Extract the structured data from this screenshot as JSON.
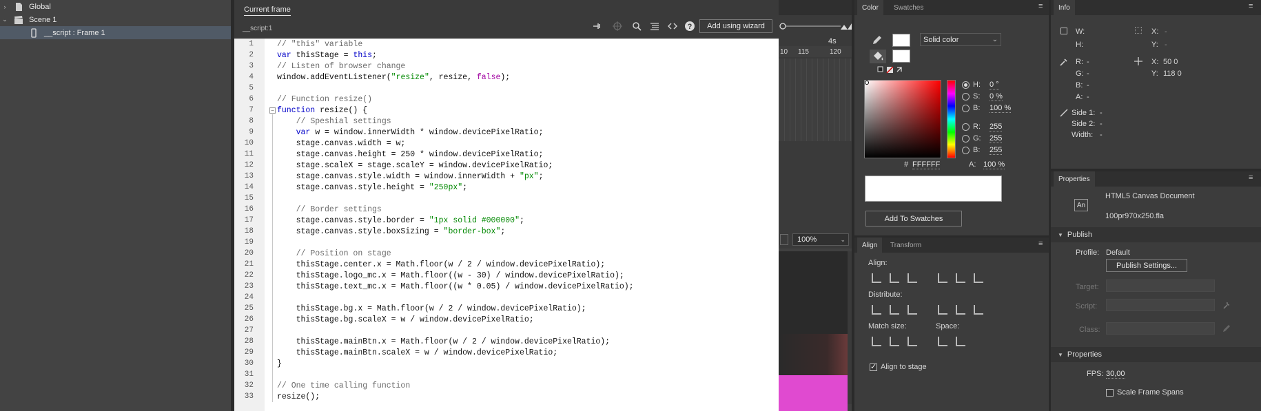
{
  "tree": {
    "items": [
      {
        "label": "Global",
        "arrow": "›",
        "icon": "document-icon"
      },
      {
        "label": "Scene 1",
        "arrow": "⌄",
        "icon": "clapperboard-icon"
      },
      {
        "label": "__script : Frame 1",
        "arrow": "",
        "icon": "phone-frame-icon"
      }
    ]
  },
  "actions": {
    "tab": "Current frame",
    "path": "__script:1",
    "wizard_label": "Add using wizard",
    "help_glyph": "?"
  },
  "code": {
    "line_numbers": [
      "1",
      "2",
      "3",
      "4",
      "5",
      "6",
      "7",
      "8",
      "9",
      "10",
      "11",
      "12",
      "13",
      "14",
      "15",
      "16",
      "17",
      "18",
      "19",
      "20",
      "21",
      "22",
      "23",
      "24",
      "25",
      "26",
      "27",
      "28",
      "29",
      "30",
      "31",
      "32",
      "33"
    ],
    "lines": [
      {
        "segs": [
          {
            "t": "// \"this\" variable",
            "c": "cm"
          }
        ]
      },
      {
        "segs": [
          {
            "t": "var",
            "c": "kw"
          },
          {
            "t": " thisStage = "
          },
          {
            "t": "this",
            "c": "kw"
          },
          {
            "t": ";"
          }
        ]
      },
      {
        "segs": [
          {
            "t": "// Listen of browser change",
            "c": "cm"
          }
        ]
      },
      {
        "segs": [
          {
            "t": "window.addEventListener("
          },
          {
            "t": "\"resize\"",
            "c": "str"
          },
          {
            "t": ", resize, "
          },
          {
            "t": "false",
            "c": "bool"
          },
          {
            "t": ");"
          }
        ]
      },
      {
        "segs": []
      },
      {
        "segs": [
          {
            "t": "// Function resize()",
            "c": "cm"
          }
        ]
      },
      {
        "segs": [
          {
            "t": "function",
            "c": "kw"
          },
          {
            "t": " resize() {"
          }
        ]
      },
      {
        "segs": [
          {
            "t": "    "
          },
          {
            "t": "// Speshial settings",
            "c": "cm"
          }
        ]
      },
      {
        "segs": [
          {
            "t": "    "
          },
          {
            "t": "var",
            "c": "kw"
          },
          {
            "t": " w = window.innerWidth * window.devicePixelRatio;"
          }
        ]
      },
      {
        "segs": [
          {
            "t": "    stage.canvas.width = w;"
          }
        ]
      },
      {
        "segs": [
          {
            "t": "    stage.canvas.height = 250 * window.devicePixelRatio;"
          }
        ]
      },
      {
        "segs": [
          {
            "t": "    stage.scaleX = stage.scaleY = window.devicePixelRatio;"
          }
        ]
      },
      {
        "segs": [
          {
            "t": "    stage.canvas.style.width = window.innerWidth + "
          },
          {
            "t": "\"px\"",
            "c": "str"
          },
          {
            "t": ";"
          }
        ]
      },
      {
        "segs": [
          {
            "t": "    stage.canvas.style.height = "
          },
          {
            "t": "\"250px\"",
            "c": "str"
          },
          {
            "t": ";"
          }
        ]
      },
      {
        "segs": []
      },
      {
        "segs": [
          {
            "t": "    "
          },
          {
            "t": "// Border settings",
            "c": "cm"
          }
        ]
      },
      {
        "segs": [
          {
            "t": "    stage.canvas.style.border = "
          },
          {
            "t": "\"1px solid #000000\"",
            "c": "str"
          },
          {
            "t": ";"
          }
        ]
      },
      {
        "segs": [
          {
            "t": "    stage.canvas.style.boxSizing = "
          },
          {
            "t": "\"border-box\"",
            "c": "str"
          },
          {
            "t": ";"
          }
        ]
      },
      {
        "segs": []
      },
      {
        "segs": [
          {
            "t": "    "
          },
          {
            "t": "// Position on stage",
            "c": "cm"
          }
        ]
      },
      {
        "segs": [
          {
            "t": "    thisStage.center.x = Math.floor(w / 2 / window.devicePixelRatio);"
          }
        ]
      },
      {
        "segs": [
          {
            "t": "    thisStage.logo_mc.x = Math.floor((w - 30) / window.devicePixelRatio);"
          }
        ]
      },
      {
        "segs": [
          {
            "t": "    thisStage.text_mc.x = Math.floor((w * 0.05) / window.devicePixelRatio);"
          }
        ]
      },
      {
        "segs": []
      },
      {
        "segs": [
          {
            "t": "    thisStage.bg.x = Math.floor(w / 2 / window.devicePixelRatio);"
          }
        ]
      },
      {
        "segs": [
          {
            "t": "    thisStage.bg.scaleX = w / window.devicePixelRatio;"
          }
        ]
      },
      {
        "segs": []
      },
      {
        "segs": [
          {
            "t": "    thisStage.mainBtn.x = Math.floor(w / 2 / window.devicePixelRatio);"
          }
        ]
      },
      {
        "segs": [
          {
            "t": "    thisStage.mainBtn.scaleX = w / window.devicePixelRatio;"
          }
        ]
      },
      {
        "segs": [
          {
            "t": "}"
          }
        ]
      },
      {
        "segs": []
      },
      {
        "segs": [
          {
            "t": "// One time calling function",
            "c": "cm"
          }
        ]
      },
      {
        "segs": [
          {
            "t": "resize();"
          }
        ]
      }
    ]
  },
  "timeline": {
    "marker": "4s",
    "frames": [
      "10",
      "115",
      "120"
    ],
    "zoom": "100%"
  },
  "color": {
    "tabs": [
      "Color",
      "Swatches"
    ],
    "fill_type": "Solid color",
    "hex": "FFFFFF",
    "hex_label": "#",
    "alpha_label": "A:",
    "alpha": "100 %",
    "add_button": "Add To Swatches",
    "hsb": [
      {
        "label": "H:",
        "value": "0 °",
        "selected": true
      },
      {
        "label": "S:",
        "value": "0 %",
        "selected": false
      },
      {
        "label": "B:",
        "value": "100 %",
        "selected": false
      }
    ],
    "rgb": [
      {
        "label": "R:",
        "value": "255"
      },
      {
        "label": "G:",
        "value": "255"
      },
      {
        "label": "B:",
        "value": "255"
      }
    ],
    "swatch_color": "#ffffff",
    "gradient_hue": "#ff0000"
  },
  "align": {
    "tabs": [
      "Align",
      "Transform"
    ],
    "align_label": "Align:",
    "distribute_label": "Distribute:",
    "match_label": "Match size:",
    "space_label": "Space:",
    "stage_label": "Align to stage",
    "align_to_stage": true
  },
  "info": {
    "title": "Info",
    "w_label": "W:",
    "h_label": "H:",
    "x_label": "X:",
    "y_label": "Y:",
    "x_value": "-",
    "y_value": "-",
    "r_label": "R:",
    "r_value": "-",
    "g_label": "G:",
    "g_value": "-",
    "b_label": "B:",
    "b_value": "-",
    "a_label": "A:",
    "a_value": "-",
    "cx_label": "X:",
    "cx_value": "50 0",
    "cy_label": "Y:",
    "cy_value": "118 0",
    "side1_label": "Side 1:",
    "side1": "-",
    "side2_label": "Side 2:",
    "side2": "-",
    "width_label": "Width:",
    "width": "-"
  },
  "properties": {
    "title": "Properties",
    "doc_type": "HTML5 Canvas Document",
    "doc_icon": "An",
    "file_name": "100pr970x250.fla",
    "publish_section": "Publish",
    "profile_label": "Profile:",
    "profile_value": "Default",
    "publish_button": "Publish Settings...",
    "target_label": "Target:",
    "script_label": "Script:",
    "class_label": "Class:",
    "props_section": "Properties",
    "fps_label": "FPS:",
    "fps_value": "30,00",
    "scale_label": "Scale Frame Spans",
    "scale_checked": false
  }
}
